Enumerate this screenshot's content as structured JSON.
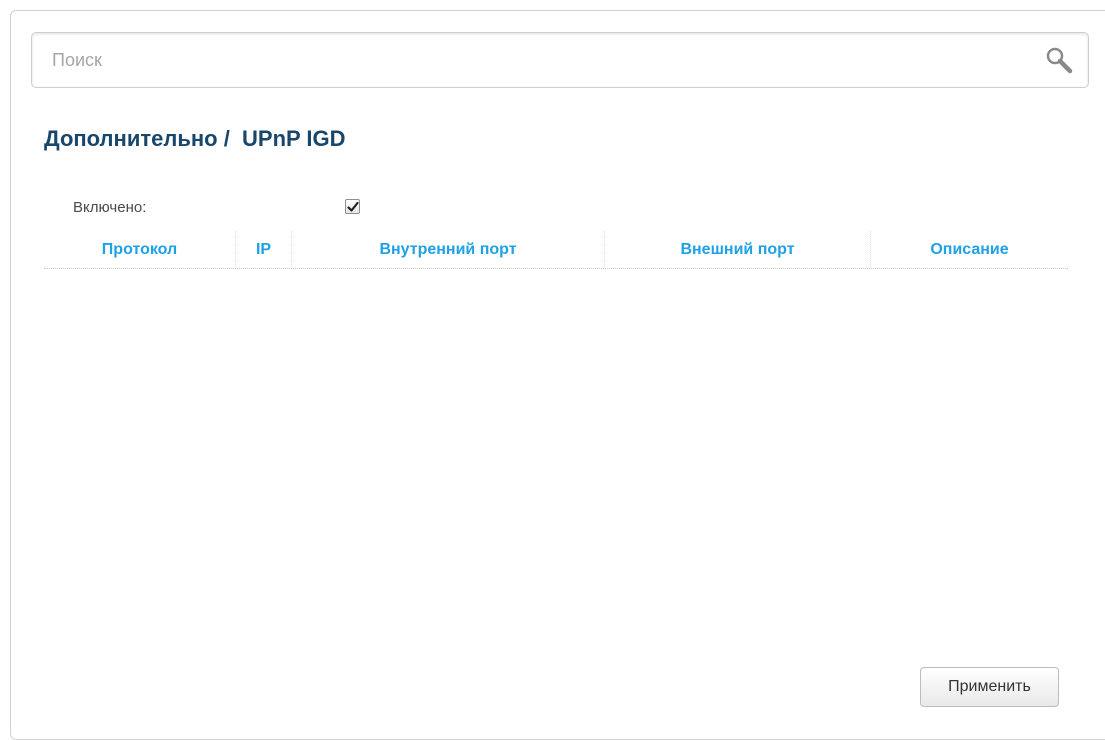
{
  "search": {
    "placeholder": "Поиск",
    "value": ""
  },
  "page": {
    "title": "Дополнительно /  UPnP IGD"
  },
  "settings": {
    "enabled_label": "Включено:",
    "enabled_checked": true
  },
  "table": {
    "columns": [
      "Протокол",
      "IP",
      "Внутренний порт",
      "Внешний порт",
      "Описание"
    ],
    "rows": []
  },
  "actions": {
    "apply_label": "Применить"
  },
  "colors": {
    "title": "#18476b",
    "column_header": "#1ea1e6",
    "border": "#d2d2d2"
  },
  "icons": {
    "search": "search-icon",
    "checkmark": "checkmark-icon"
  }
}
